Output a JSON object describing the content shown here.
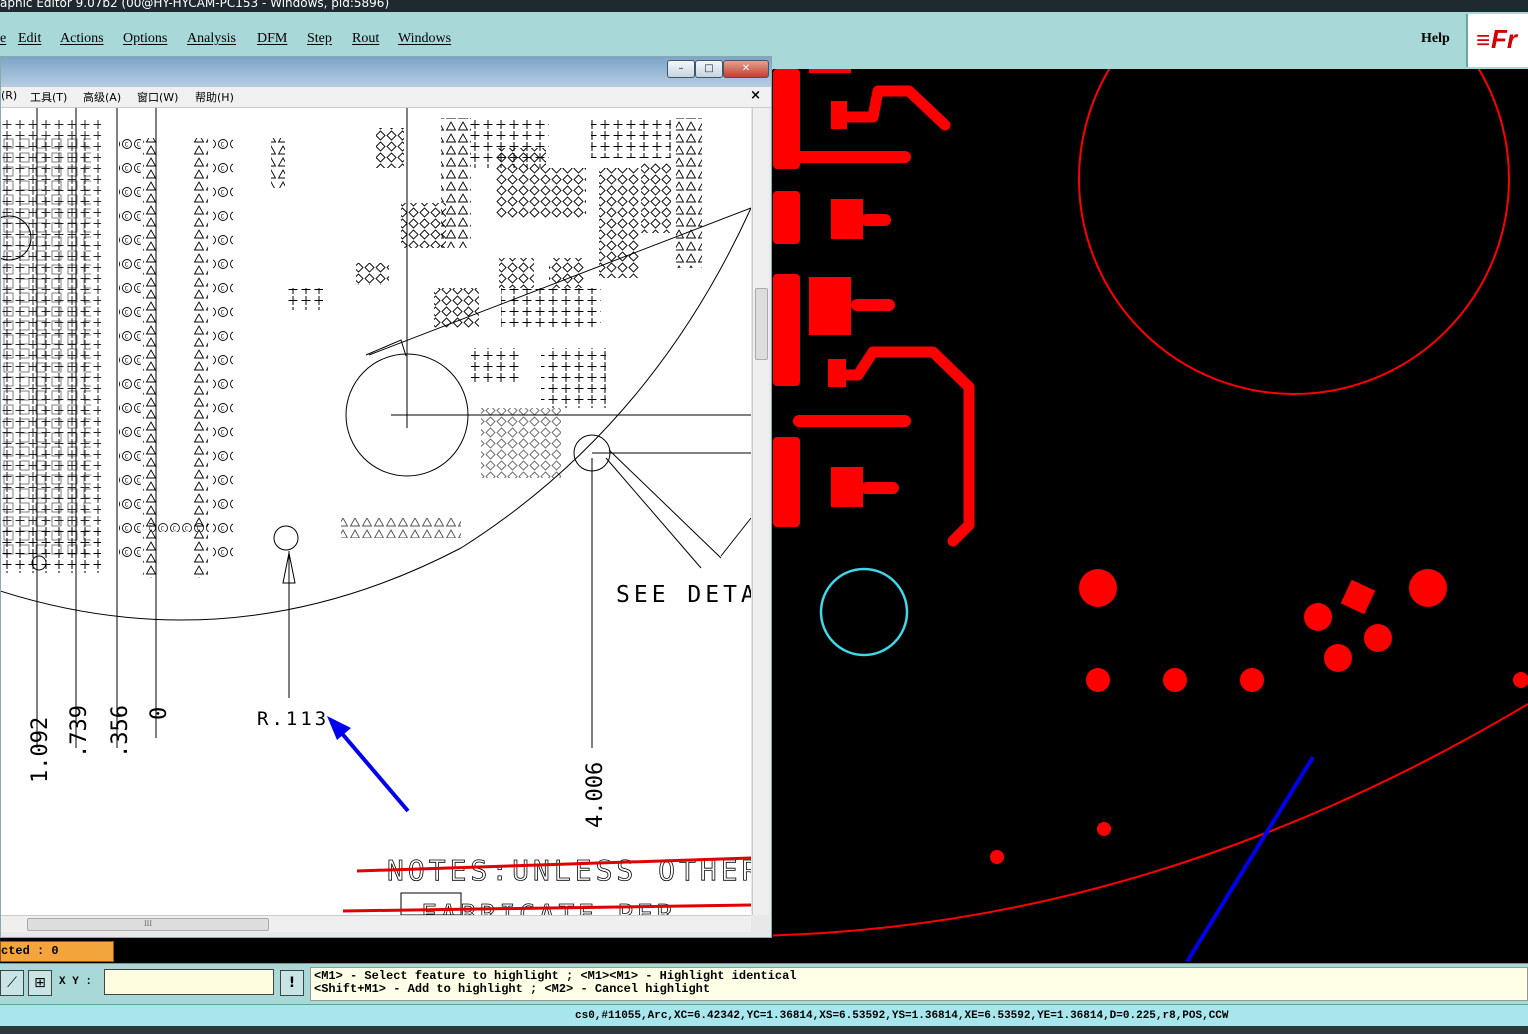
{
  "window": {
    "title": "aphic Editor 9.07b2 (00@HY-HYCAM-PC153 - Windows, pid:5896)"
  },
  "menubar": {
    "items": [
      "e",
      "Edit",
      "Actions",
      "Options",
      "Analysis",
      "DFM",
      "Step",
      "Rout",
      "Windows"
    ],
    "help": "Help",
    "logo": "Fr"
  },
  "viewer": {
    "menu": [
      "(R)",
      "工具(T)",
      "高级(A)",
      "窗口(W)",
      "帮助(H)"
    ],
    "close_glyph": "×",
    "minimize_glyph": "–",
    "maximize_glyph": "□",
    "window_close_glyph": "✕",
    "drawing": {
      "dims_left": [
        "1.092",
        ".739",
        ".356",
        "0"
      ],
      "dim_right": "4.006",
      "radius_label": "R.113",
      "see_detail": "SEE DETA",
      "notes": "NOTES:UNLESS OTHER",
      "fab_note": "FABRICATE PER"
    },
    "hscroll_grip": "III"
  },
  "selected": {
    "text": "cted : 0"
  },
  "toolbar": {
    "xy_label": "X Y :",
    "xy_value": "",
    "warn_glyph": "!",
    "hint_line1": "<M1> - Select feature to highlight ; <M1><M1> - Highlight identical",
    "hint_line2": "<Shift+M1> - Add to highlight ; <M2> - Cancel highlight"
  },
  "status": {
    "text": "cs0,#11055,Arc,XC=6.42342,YC=1.36814,XS=6.53592,YS=1.36814,XE=6.53592,YE=1.36814,D=0.225,r8,POS,CCW"
  },
  "colors": {
    "panel_bg": "#a8d8d8",
    "feature_red": "#ff0000",
    "highlight_cyan": "#3fd8e8",
    "annotation_blue": "#0000ee",
    "selected_bg": "#f3a53b"
  }
}
